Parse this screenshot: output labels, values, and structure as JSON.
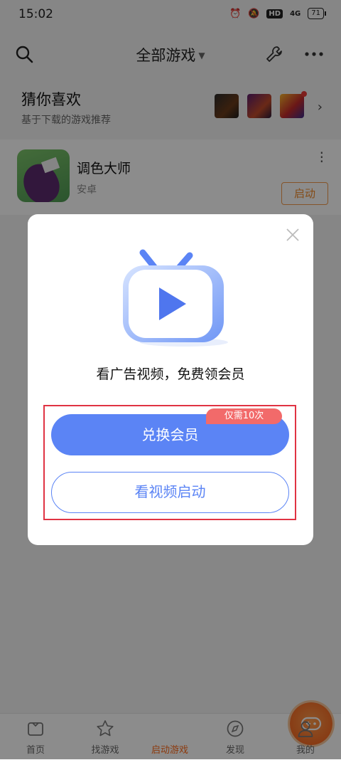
{
  "status_bar": {
    "time": "15:02",
    "hd": "HD",
    "network": "4G",
    "battery": "71"
  },
  "header": {
    "title": "全部游戏"
  },
  "recommend": {
    "title": "猜你喜欢",
    "subtitle": "基于下载的游戏推荐"
  },
  "game": {
    "name": "调色大师",
    "platform": "安卓",
    "start_label": "启动"
  },
  "dialog": {
    "message": "看广告视频，免费领会员",
    "exchange_label": "兑换会员",
    "badge": "仅需10次",
    "watch_label": "看视频启动"
  },
  "tabs": [
    {
      "label": "首页"
    },
    {
      "label": "找游戏"
    },
    {
      "label": "启动游戏"
    },
    {
      "label": "发现"
    },
    {
      "label": "我的"
    }
  ],
  "colors": {
    "accent": "#5b84f5",
    "orange": "#ff6a1a",
    "highlight": "#e03343"
  }
}
